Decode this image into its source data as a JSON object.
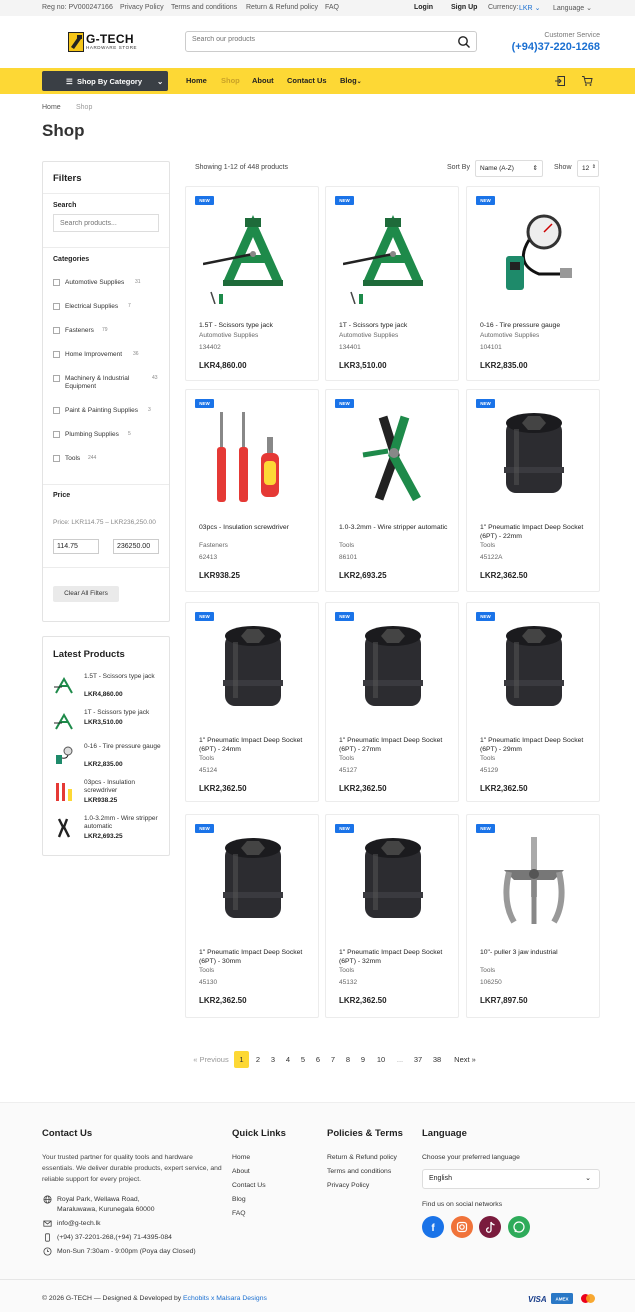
{
  "topbar": {
    "reg_no": "Reg no: PV000247166",
    "privacy": "Privacy Policy",
    "terms": "Terms and conditions",
    "refund": "Return & Refund policy",
    "faq": "FAQ",
    "login": "Login",
    "signup": "Sign Up",
    "currency_label": "Currency:",
    "currency_value": "LKR",
    "language": "Language"
  },
  "header": {
    "logo_title": "G-TECH",
    "logo_sub": "HARDWARE STORE",
    "search_placeholder": "Search our products",
    "cs_label": "Customer Service",
    "cs_phone": "(+94)37-220-1268"
  },
  "nav": {
    "category_button": "Shop By Category",
    "links": [
      "Home",
      "Shop",
      "About",
      "Contact Us",
      "Blog"
    ],
    "active": "Shop",
    "accent": "#fdd835"
  },
  "breadcrumb": [
    "Home",
    "Shop"
  ],
  "page_title": "Shop",
  "filters": {
    "title": "Filters",
    "search_label": "Search",
    "search_placeholder": "Search products...",
    "categories_label": "Categories",
    "categories": [
      {
        "name": "Automotive Supplies",
        "count": "31"
      },
      {
        "name": "Electrical Supplies",
        "count": "7"
      },
      {
        "name": "Fasteners",
        "count": "79"
      },
      {
        "name": "Home Improvement",
        "count": "36"
      },
      {
        "name": "Machinery & Industrial Equipment",
        "count": "43"
      },
      {
        "name": "Paint & Painting Supplies",
        "count": "3"
      },
      {
        "name": "Plumbing Supplies",
        "count": "5"
      },
      {
        "name": "Tools",
        "count": "244"
      }
    ],
    "price_label": "Price",
    "price_range": "Price: LKR114.75 – LKR236,250.00",
    "price_min": "114.75",
    "price_max": "236250.00",
    "clear_button": "Clear All Filters"
  },
  "latest": {
    "title": "Latest Products",
    "items": [
      {
        "name": "1.5T - Scissors type jack",
        "price": "LKR4,860.00",
        "icon": "jack-thumb-icon"
      },
      {
        "name": "1T - Scissors type jack",
        "price": "LKR3,510.00",
        "icon": "jack-thumb-icon"
      },
      {
        "name": "0-16 - Tire pressure gauge",
        "price": "LKR2,835.00",
        "icon": "gauge-thumb-icon"
      },
      {
        "name": "03pcs - Insulation screwdriver",
        "price": "LKR938.25",
        "icon": "screwdriver-thumb-icon"
      },
      {
        "name": "1.0-3.2mm - Wire stripper automatic",
        "price": "LKR2,693.25",
        "icon": "stripper-thumb-icon"
      }
    ]
  },
  "toolbar": {
    "showing": "Showing 1-12 of 448 products",
    "sort_label": "Sort By",
    "sort_value": "Name (A-Z)",
    "show_label": "Show",
    "show_value": "12"
  },
  "products": [
    {
      "badge": "NEW",
      "name": "1.5T - Scissors type jack",
      "category": "Automotive Supplies",
      "sku": "134402",
      "price": "LKR4,860.00",
      "image": "jack"
    },
    {
      "badge": "NEW",
      "name": "1T - Scissors type jack",
      "category": "Automotive Supplies",
      "sku": "134401",
      "price": "LKR3,510.00",
      "image": "jack"
    },
    {
      "badge": "NEW",
      "name": "0-16 - Tire pressure gauge",
      "category": "Automotive Supplies",
      "sku": "104101",
      "price": "LKR2,835.00",
      "image": "gauge"
    },
    {
      "badge": "NEW",
      "name": "03pcs - Insulation screwdriver",
      "category": "Fasteners",
      "sku": "62413",
      "price": "LKR938.25",
      "image": "screwdriver"
    },
    {
      "badge": "NEW",
      "name": "1.0-3.2mm - Wire stripper automatic",
      "category": "Tools",
      "sku": "86101",
      "price": "LKR2,693.25",
      "image": "stripper"
    },
    {
      "badge": "NEW",
      "name": "1\" Pneumatic Impact Deep Socket (6PT) - 22mm",
      "category": "Tools",
      "sku": "45122A",
      "price": "LKR2,362.50",
      "image": "socket"
    },
    {
      "badge": "NEW",
      "name": "1\" Pneumatic Impact Deep Socket (6PT) - 24mm",
      "category": "Tools",
      "sku": "45124",
      "price": "LKR2,362.50",
      "image": "socket"
    },
    {
      "badge": "NEW",
      "name": "1\" Pneumatic Impact Deep Socket (6PT) - 27mm",
      "category": "Tools",
      "sku": "45127",
      "price": "LKR2,362.50",
      "image": "socket"
    },
    {
      "badge": "NEW",
      "name": "1\" Pneumatic Impact Deep Socket (6PT) - 29mm",
      "category": "Tools",
      "sku": "45129",
      "price": "LKR2,362.50",
      "image": "socket"
    },
    {
      "badge": "NEW",
      "name": "1\" Pneumatic Impact Deep Socket (6PT) - 30mm",
      "category": "Tools",
      "sku": "45130",
      "price": "LKR2,362.50",
      "image": "socket"
    },
    {
      "badge": "NEW",
      "name": "1\" Pneumatic Impact Deep Socket (6PT) - 32mm",
      "category": "Tools",
      "sku": "45132",
      "price": "LKR2,362.50",
      "image": "socket"
    },
    {
      "badge": "NEW",
      "name": "10\"- puller 3 jaw industrial",
      "category": "Tools",
      "sku": "106250",
      "price": "LKR7,897.50",
      "image": "puller"
    }
  ],
  "pagination": {
    "prev": "« Previous",
    "pages": [
      "1",
      "2",
      "3",
      "4",
      "5",
      "6",
      "7",
      "8",
      "9",
      "10",
      "...",
      "37",
      "38"
    ],
    "current": "1",
    "next": "Next »"
  },
  "footer": {
    "contact_title": "Contact Us",
    "about": "Your trusted partner for quality tools and hardware essentials. We deliver durable products, expert service, and reliable support for every project.",
    "address": "Royal Park, Wellawa Road, Maraluwawa, Kurunegala 60000",
    "email": "info@g-tech.lk",
    "phone": "(+94) 37-2201-268,(+94) 71-4395-084",
    "hours": "Mon-Sun 7:30am - 9:00pm (Poya day Closed)",
    "quick_title": "Quick Links",
    "quick_links": [
      "Home",
      "About",
      "Contact Us",
      "Blog",
      "FAQ"
    ],
    "policies_title": "Policies & Terms",
    "policies": [
      "Return & Refund policy",
      "Terms and conditions",
      "Privacy Policy"
    ],
    "language_title": "Language",
    "language_label": "Choose your preferred language",
    "language_value": "English",
    "social_label": "Find us on social networks",
    "social": [
      "facebook-icon",
      "instagram-icon",
      "tiktok-icon",
      "whatsapp-icon"
    ],
    "copyright": "© 2026 G-TECH — Designed & Developed by",
    "dev_brand": "Echobits x Malsara Designs",
    "payments": [
      "VISA",
      "AMEX",
      "mastercard"
    ]
  }
}
